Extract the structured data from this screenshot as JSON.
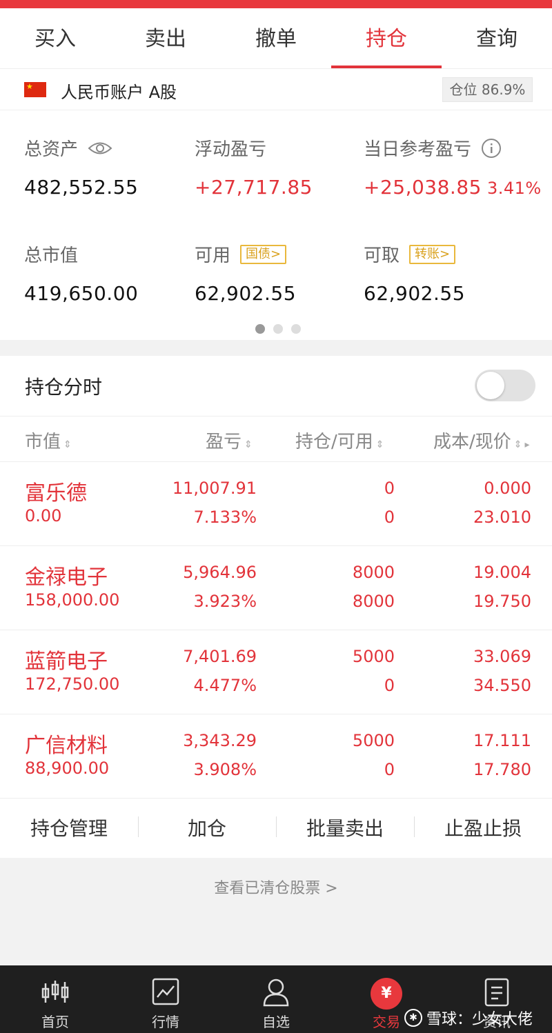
{
  "tabs": [
    {
      "label": "买入"
    },
    {
      "label": "卖出"
    },
    {
      "label": "撤单"
    },
    {
      "label": "持仓"
    },
    {
      "label": "查询"
    }
  ],
  "account": {
    "name": "人民币账户 A股",
    "position": "仓位 86.9%"
  },
  "summary": {
    "total_assets_label": "总资产",
    "total_assets": "482,552.55",
    "float_pl_label": "浮动盈亏",
    "float_pl": "+27,717.85",
    "daily_pl_label": "当日参考盈亏",
    "daily_pl": "+25,038.85",
    "daily_pl_pct": "3.41%",
    "market_value_label": "总市值",
    "market_value": "419,650.00",
    "available_label": "可用",
    "available_tag": "国债>",
    "available": "62,902.55",
    "withdrawable_label": "可取",
    "withdrawable_tag": "转账>",
    "withdrawable": "62,902.55"
  },
  "section": {
    "timeshare_label": "持仓分时",
    "columns": [
      "市值",
      "盈亏",
      "持仓/可用",
      "成本/现价"
    ]
  },
  "holdings": [
    {
      "name": "富乐德",
      "market_value": "0.00",
      "pl": "11,007.91",
      "pl_pct": "7.133%",
      "position": "0",
      "available": "0",
      "cost": "0.000",
      "price": "23.010"
    },
    {
      "name": "金禄电子",
      "market_value": "158,000.00",
      "pl": "5,964.96",
      "pl_pct": "3.923%",
      "position": "8000",
      "available": "8000",
      "cost": "19.004",
      "price": "19.750"
    },
    {
      "name": "蓝箭电子",
      "market_value": "172,750.00",
      "pl": "7,401.69",
      "pl_pct": "4.477%",
      "position": "5000",
      "available": "0",
      "cost": "33.069",
      "price": "34.550"
    },
    {
      "name": "广信材料",
      "market_value": "88,900.00",
      "pl": "3,343.29",
      "pl_pct": "3.908%",
      "position": "5000",
      "available": "0",
      "cost": "17.111",
      "price": "17.780"
    }
  ],
  "actions": [
    "持仓管理",
    "加仓",
    "批量卖出",
    "止盈止损"
  ],
  "cleared_link": "查看已清仓股票 >",
  "bottom_nav": [
    {
      "label": "首页",
      "icon": "candlestick-icon"
    },
    {
      "label": "行情",
      "icon": "chart-line-icon"
    },
    {
      "label": "自选",
      "icon": "user-icon"
    },
    {
      "label": "交易",
      "icon": "yen-icon"
    },
    {
      "label": "资讯",
      "icon": "document-icon"
    }
  ],
  "watermark": "雪球：少女大佬",
  "colors": {
    "accent": "#e2333a",
    "tag": "#e9b83b",
    "nav_bg": "#1f1f1f"
  }
}
